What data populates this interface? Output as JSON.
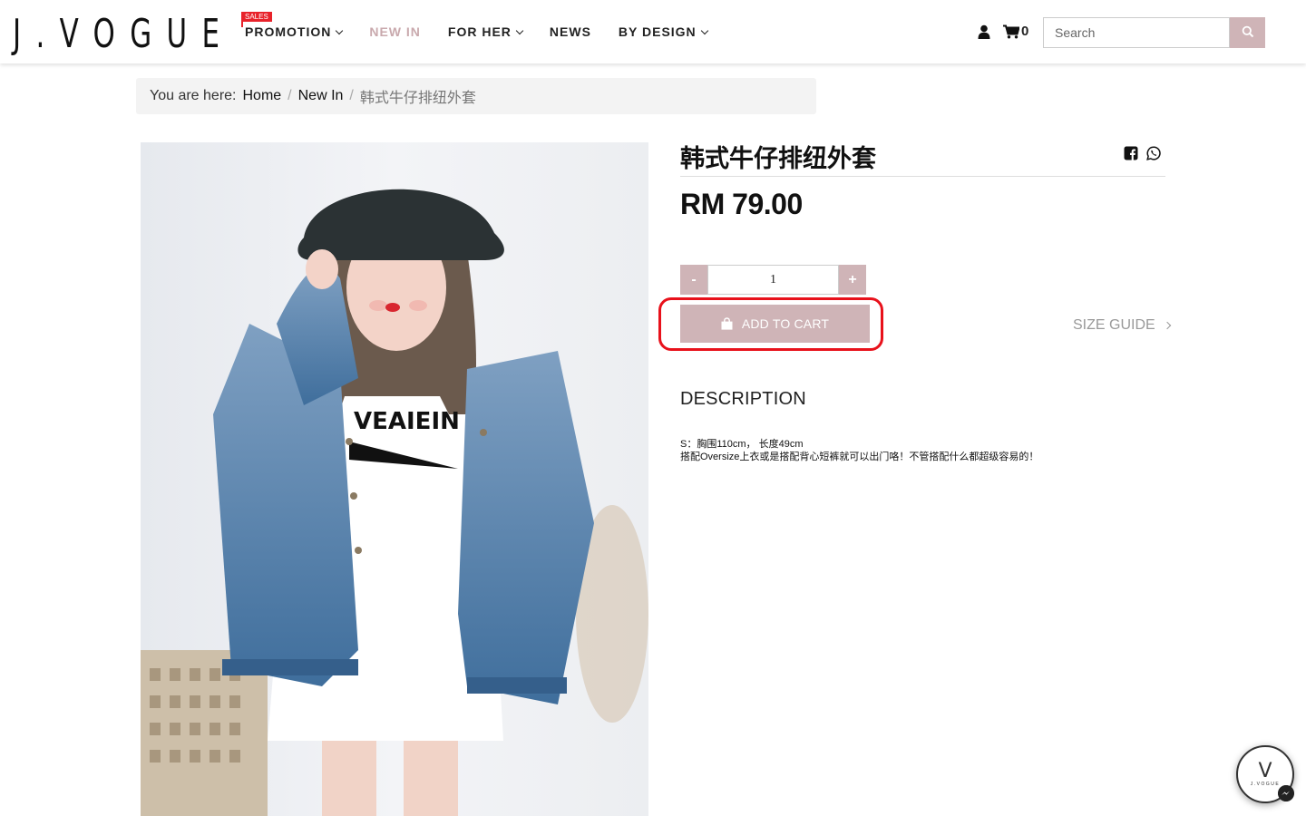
{
  "header": {
    "logo_text": "J.VOGUE",
    "nav": [
      {
        "label": "PROMOTION",
        "badge": "SALES",
        "has_dropdown": true
      },
      {
        "label": "NEW IN",
        "active": true,
        "has_dropdown": false
      },
      {
        "label": "FOR HER",
        "has_dropdown": true
      },
      {
        "label": "NEWS",
        "has_dropdown": false
      },
      {
        "label": "BY DESIGN",
        "has_dropdown": true
      }
    ],
    "cart_count": "0",
    "search_placeholder": "Search",
    "icons": [
      "user-icon",
      "cart-icon",
      "search-icon"
    ]
  },
  "breadcrumb": {
    "prefix": "You are here:",
    "items": [
      "Home",
      "New In"
    ],
    "current": "韩式牛仔排纽外套"
  },
  "product": {
    "title": "韩式牛仔排纽外套",
    "price": "RM 79.00",
    "quantity": "1",
    "minus_label": "-",
    "plus_label": "+",
    "add_to_cart_label": "ADD TO CART",
    "size_guide_label": "SIZE GUIDE",
    "description_heading": "DESCRIPTION",
    "description_lines": [
      "S：胸围110cm， 长度49cm",
      "搭配Oversize上衣或是搭配背心短裤就可以出门咯！不管搭配什么都超级容易的！"
    ],
    "share_icons": [
      "facebook-icon",
      "whatsapp-icon"
    ]
  },
  "chat_widget": {
    "mark": "V",
    "name": "J.VOGUE"
  },
  "colors": {
    "accent": "#cfb4b7",
    "active_nav": "#c9a9ad",
    "sales_badge": "#e8222a",
    "highlight": "#e8111b"
  }
}
